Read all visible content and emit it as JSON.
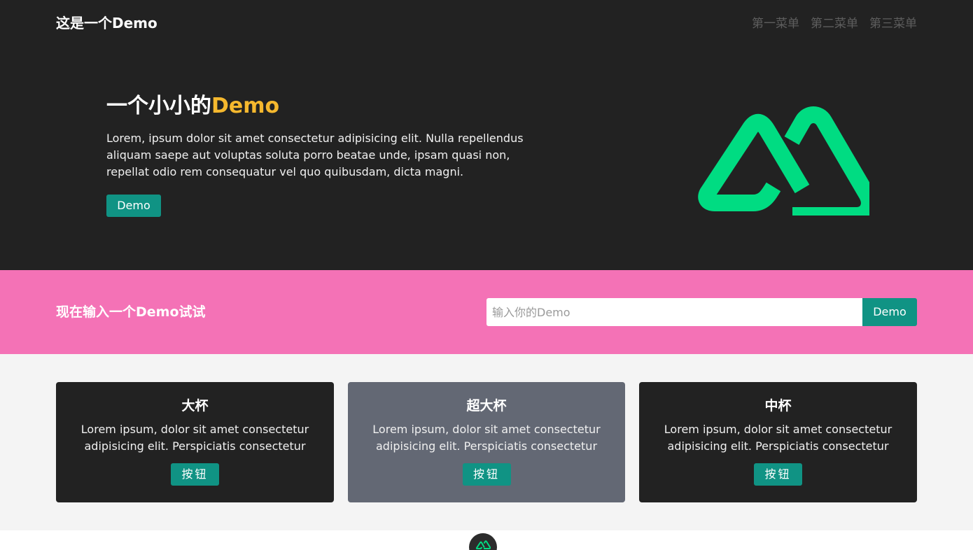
{
  "header": {
    "brand": "这是一个Demo",
    "menu": [
      "第一菜单",
      "第二菜单",
      "第三菜单"
    ]
  },
  "hero": {
    "title_prefix": "一个小小的",
    "title_accent": "Demo",
    "description": "Lorem, ipsum dolor sit amet consectetur adipisicing elit. Nulla repellendus aliquam saepe aut voluptas soluta porro beatae unde, ipsam quasi non, repellat odio rem consequatur vel quo quibusdam, dicta magni.",
    "button_label": "Demo",
    "logo_icon": "nuxt-logo-icon"
  },
  "band": {
    "title": "现在输入一个Demo试试",
    "input_placeholder": "输入你的Demo",
    "input_value": "",
    "button_label": "Demo"
  },
  "cards": [
    {
      "title": "大杯",
      "description": "Lorem ipsum, dolor sit amet consectetur adipisicing elit. Perspiciatis consectetur",
      "button_label": "按钮"
    },
    {
      "title": "超大杯",
      "description": "Lorem ipsum, dolor sit amet consectetur adipisicing elit. Perspiciatis consectetur",
      "button_label": "按钮"
    },
    {
      "title": "中杯",
      "description": "Lorem ipsum, dolor sit amet consectetur adipisicing elit. Perspiciatis consectetur",
      "button_label": "按钮"
    }
  ],
  "footer": {
    "badge_icon": "nuxt-logo-icon"
  },
  "colors": {
    "dark": "#222222",
    "accent": "#f5b82e",
    "button": "#109384",
    "band": "#f472b6",
    "logo": "#00dc82",
    "card_highlight": "#636874"
  }
}
